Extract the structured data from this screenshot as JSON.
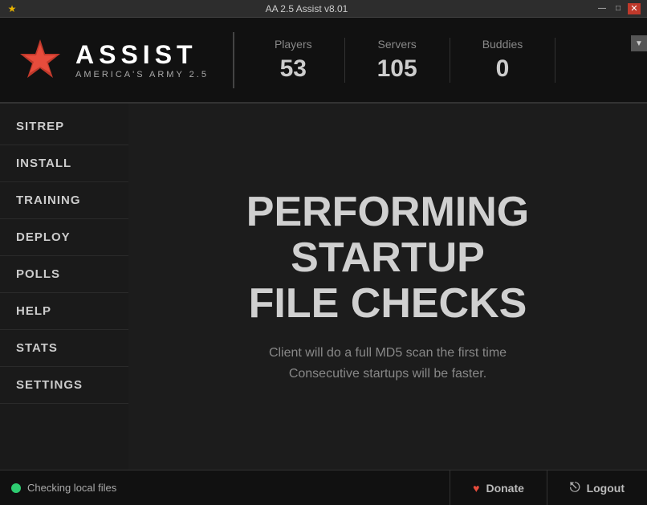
{
  "titlebar": {
    "title": "AA 2.5 Assist v8.01",
    "icon": "★",
    "minimize_label": "—",
    "maximize_label": "□",
    "close_label": "✕"
  },
  "header": {
    "logo_text": "ASSIST",
    "logo_subtitle": "AMERICA'S ARMY 2.5",
    "stats": [
      {
        "label": "Players",
        "value": "53"
      },
      {
        "label": "Servers",
        "value": "105"
      },
      {
        "label": "Buddies",
        "value": "0"
      }
    ]
  },
  "sidebar": {
    "items": [
      {
        "label": "SITREP"
      },
      {
        "label": "INSTALL"
      },
      {
        "label": "TRAINING"
      },
      {
        "label": "DEPLOY"
      },
      {
        "label": "POLLS"
      },
      {
        "label": "HELP"
      },
      {
        "label": "STATS"
      },
      {
        "label": "SETTINGS"
      }
    ]
  },
  "content": {
    "heading_line1": "PERFORMING STARTUP",
    "heading_line2": "FILE CHECKS",
    "sub_line1": "Client will do a full MD5 scan the first time",
    "sub_line2": "Consecutive startups will be faster."
  },
  "statusbar": {
    "status_text": "Checking local files",
    "donate_label": "Donate",
    "logout_label": "Logout"
  }
}
